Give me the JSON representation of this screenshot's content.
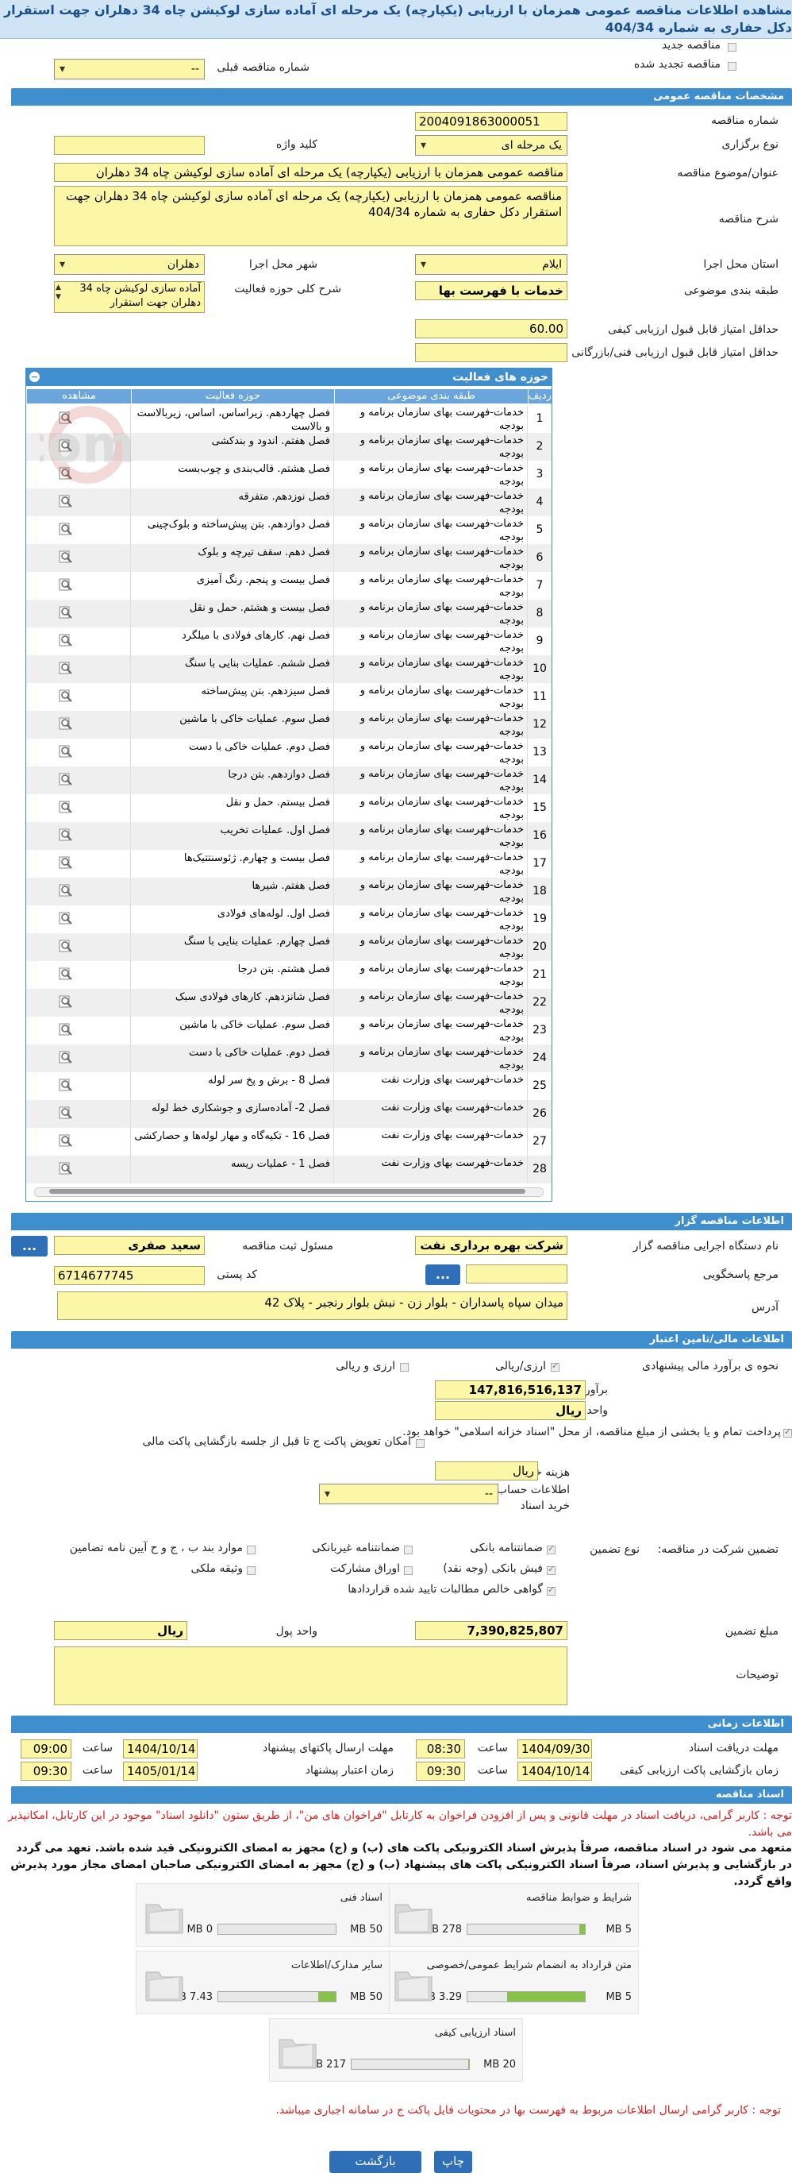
{
  "page": {
    "title": "مشاهده اطلاعات مناقصه عمومی همزمان با ارزیابی (یکپارچه) یک مرحله ای آماده سازی لوکیشن چاه 34 دهلران جهت استقرار دکل حفاری به شماره 404/34"
  },
  "top": {
    "new_tender": "مناقصه جدید",
    "renewed_tender": "مناقصه تجدید شده",
    "prev_tender_label": "شماره مناقصه قبلی",
    "prev_tender_value": "--"
  },
  "general": {
    "section": "مشخصات مناقصه عمومی",
    "tender_no_label": "شماره مناقصه",
    "tender_no": "2004091863000051",
    "type_label": "نوع برگزاری",
    "type_value": "یک مرحله ای",
    "keyword_label": "کلید واژه",
    "keyword_value": "",
    "subject_label": "عنوان/موضوع مناقصه",
    "subject_value": "مناقصه عمومی همزمان با ارزیابی (یکپارچه) یک مرحله ای آماده سازی لوکیشن چاه 34 دهلران",
    "desc_label": "شرح مناقصه",
    "desc_value": "مناقصه عمومی همزمان با ارزیابی (یکپارچه) یک مرحله ای آماده سازی لوکیشن چاه 34 دهلران جهت استقرار دکل حفاری به شماره 404/34",
    "province_label": "استان محل اجرا",
    "province_value": "ایلام",
    "city_label": "شهر محل اجرا",
    "city_value": "دهلران",
    "category_label": "طبقه بندی موضوعی",
    "category_value": "خدمات با فهرست بها",
    "scope_label": "شرح کلی حوزه فعالیت",
    "scope_value": "آماده سازی لوکیشن چاه 34 دهلران جهت استقرار",
    "min_quality_label": "حداقل امتیاز قابل قبول ارزیابی کیفی",
    "min_quality_value": "60.00",
    "min_tech_label": "حداقل امتیاز قابل قبول ارزیابی فنی/بازرگانی",
    "min_tech_value": ""
  },
  "activities": {
    "title": "حوزه های فعالیت",
    "col_row": "ردیف",
    "col_cat": "طبقه بندی موضوعی",
    "col_act": "حوزه فعالیت",
    "col_view": "مشاهده",
    "rows": [
      {
        "n": "1",
        "cat": "خدمات-فهرست بهای سازمان برنامه و بودجه",
        "act": "فصل چهاردهم. زیراساس، اساس، زیربالاست و بالاست"
      },
      {
        "n": "2",
        "cat": "خدمات-فهرست بهای سازمان برنامه و بودجه",
        "act": "فصل هفتم. اندود و بندکشی"
      },
      {
        "n": "3",
        "cat": "خدمات-فهرست بهای سازمان برنامه و بودجه",
        "act": "فصل هشتم. قالب‌بندی و چوب‌بست"
      },
      {
        "n": "4",
        "cat": "خدمات-فهرست بهای سازمان برنامه و بودجه",
        "act": "فصل نوزدهم. متفرقه"
      },
      {
        "n": "5",
        "cat": "خدمات-فهرست بهای سازمان برنامه و بودجه",
        "act": "فصل دوازدهم. بتن پیش‌ساخته و بلوک‌چینی"
      },
      {
        "n": "6",
        "cat": "خدمات-فهرست بهای سازمان برنامه و بودجه",
        "act": "فصل دهم. سقف تیرچه و بلوک"
      },
      {
        "n": "7",
        "cat": "خدمات-فهرست بهای سازمان برنامه و بودجه",
        "act": "فصل بیست و پنجم. رنگ آمیزی"
      },
      {
        "n": "8",
        "cat": "خدمات-فهرست بهای سازمان برنامه و بودجه",
        "act": "فصل بیست و هشتم. حمل و نقل"
      },
      {
        "n": "9",
        "cat": "خدمات-فهرست بهای سازمان برنامه و بودجه",
        "act": "فصل نهم. کارهای فولادی با میلگرد"
      },
      {
        "n": "10",
        "cat": "خدمات-فهرست بهای سازمان برنامه و بودجه",
        "act": "فصل ششم. عملیات بنایی با سنگ"
      },
      {
        "n": "11",
        "cat": "خدمات-فهرست بهای سازمان برنامه و بودجه",
        "act": "فصل سیزدهم. بتن پیش‌ساخته"
      },
      {
        "n": "12",
        "cat": "خدمات-فهرست بهای سازمان برنامه و بودجه",
        "act": "فصل سوم. عملیات خاکی با ماشین"
      },
      {
        "n": "13",
        "cat": "خدمات-فهرست بهای سازمان برنامه و بودجه",
        "act": "فصل دوم. عملیات خاکی با دست"
      },
      {
        "n": "14",
        "cat": "خدمات-فهرست بهای سازمان برنامه و بودجه",
        "act": "فصل دوازدهم. بتن درجا"
      },
      {
        "n": "15",
        "cat": "خدمات-فهرست بهای سازمان برنامه و بودجه",
        "act": "فصل بیستم. حمل و نقل"
      },
      {
        "n": "16",
        "cat": "خدمات-فهرست بهای سازمان برنامه و بودجه",
        "act": "فصل اول. عملیات تخریب"
      },
      {
        "n": "17",
        "cat": "خدمات-فهرست بهای سازمان برنامه و بودجه",
        "act": "فصل بیست و چهارم. ژئوسنتتیک‌ها"
      },
      {
        "n": "18",
        "cat": "خدمات-فهرست بهای سازمان برنامه و بودجه",
        "act": "فصل هفتم. شیرها"
      },
      {
        "n": "19",
        "cat": "خدمات-فهرست بهای سازمان برنامه و بودجه",
        "act": "فصل اول. لوله‌های فولادی"
      },
      {
        "n": "20",
        "cat": "خدمات-فهرست بهای سازمان برنامه و بودجه",
        "act": "فصل چهارم. عملیات بنایی با سنگ"
      },
      {
        "n": "21",
        "cat": "خدمات-فهرست بهای سازمان برنامه و بودجه",
        "act": "فصل هشتم. بتن درجا"
      },
      {
        "n": "22",
        "cat": "خدمات-فهرست بهای سازمان برنامه و بودجه",
        "act": "فصل شانزدهم. کارهای فولادی سبک"
      },
      {
        "n": "23",
        "cat": "خدمات-فهرست بهای سازمان برنامه و بودجه",
        "act": "فصل سوم. عملیات خاکی با ماشین"
      },
      {
        "n": "24",
        "cat": "خدمات-فهرست بهای سازمان برنامه و بودجه",
        "act": "فصل دوم. عملیات خاکی با دست"
      },
      {
        "n": "25",
        "cat": "خدمات-فهرست بهای وزارت نفت",
        "act": "فصل 8 - برش و پخ سر لوله"
      },
      {
        "n": "26",
        "cat": "خدمات-فهرست بهای وزارت نفت",
        "act": "فصل 2- آماده‌سازی و جوشکاری خط لوله"
      },
      {
        "n": "27",
        "cat": "خدمات-فهرست بهای وزارت نفت",
        "act": "فصل 16 - تکیه‌گاه و مهار لوله‌ها و حصارکشی"
      },
      {
        "n": "28",
        "cat": "خدمات-فهرست بهای وزارت نفت",
        "act": "فصل 1 - عملیات ریسه"
      }
    ]
  },
  "organizer": {
    "section": "اطلاعات مناقصه گزار",
    "org_label": "نام دستگاه اجرایی مناقصه گزار",
    "org_value": "شرکت بهره برداری نفت و گ",
    "resp_label": "مسئول ثبت مناقصه",
    "resp_value": "سعید صفری",
    "ref_label": "مرجع پاسخگویی",
    "ref_value": "",
    "postal_label": "کد پستی",
    "postal_value": "6714677745",
    "address_label": "آدرس",
    "address_value": "میدان سپاه پاسداران - بلوار زن - نبش بلوار رنجبر - پلاک 42",
    "more_btn": "...",
    "ref_btn": "..."
  },
  "finance": {
    "section": "اطلاعات مالی/تامین اعتبار",
    "estimate_type_label": "نحوه ی برآورد مالی پیشنهادی",
    "opt_rial": "ارزی/ریالی",
    "opt_rial2": "ارزی و ریالی",
    "estimate_label": "برآورد مالی",
    "estimate_value": "147,816,516,137",
    "currency_label": "واحد پول",
    "currency_value": "ریال",
    "pay_text": "پرداخت تمام و یا بخشی از مبلغ مناقصه، از محل \"اسناد خزانه اسلامی\" خواهد بود.",
    "swap_text": "امکان تعویض پاکت ج تا قبل از جلسه بازگشایی پاکت مالی",
    "doc_cost_label": "هزینه خرید اسناد",
    "doc_cost_unit": "ریال",
    "account_label": "اطلاعات حساب جهت واریز هزینه خرید اسناد",
    "account_value": "--",
    "guarantee_label": "تضمین شرکت در مناقصه:",
    "guarantee_type_label": "نوع تضمین",
    "g_bank": "ضمانتنامه بانکی",
    "g_nonbank": "ضمانتنامه غیربانکی",
    "g_items": "موارد بند ب ، ج و ح آیین نامه تضامین",
    "g_cash": "فیش بانکی (وجه نقد)",
    "g_bonds": "اوراق مشارکت",
    "g_property": "وثیقه ملکی",
    "g_claims": "گواهی خالص مطالبات تایید شده قراردادها",
    "amount_label": "مبلغ تضمین",
    "amount_value": "7,390,825,807",
    "amount_currency_label": "واحد پول",
    "amount_currency_value": "ریال",
    "notes_label": "توضیحات",
    "notes_value": ""
  },
  "timing": {
    "section": "اطلاعات زمانی",
    "doc_deadline_label": "مهلت دریافت اسناد",
    "doc_deadline_date": "1404/09/30",
    "doc_deadline_time": "08:30",
    "send_deadline_label": "مهلت ارسال پاکتهای پیشنهاد",
    "send_deadline_date": "1404/10/14",
    "send_deadline_time": "09:00",
    "open_label": "زمان بازگشایی پاکت ارزیابی کیفی",
    "open_date": "1404/10/14",
    "open_time": "09:30",
    "validity_label": "زمان اعتبار پیشنهاد",
    "validity_date": "1405/01/14",
    "validity_time": "09:30",
    "time_label": "ساعت"
  },
  "docs": {
    "section": "اسناد مناقصه",
    "notice_red": "توجه : کاربر گرامی، دریافت اسناد در مهلت قانونی و پس از افزودن فراخوان به کارتابل \"فراخوان های من\"، از طریق ستون \"دانلود اسناد\" موجود در این کارتابل، امکانپذیر می باشد.",
    "notice_black": "متعهد می شود در اسناد مناقصه، صرفاً پذیرش اسناد الکترونیکی پاکت های (ب) و (ج) مجهز به امضای الکترونیکی قید شده باشد. تعهد می گردد در بازگشایی و پذیرش اسناد، صرفاً اسناد الکترونیکی پاکت های پیشنهاد (ب) و (ج) مجهز به امضای الکترونیکی صاحبان امضای مجاز مورد پذیرش واقع گردد.",
    "cards": [
      {
        "title": "شرایط و ضوابط مناقصه",
        "max": "5 MB",
        "cur": "278 KB",
        "fill": 0.05
      },
      {
        "title": "اسناد فنی",
        "max": "50 MB",
        "cur": "0 MB",
        "fill": 0.0
      },
      {
        "title": "متن قرارداد به انضمام شرایط عمومی/خصوصی",
        "max": "5 MB",
        "cur": "3.29 MB",
        "fill": 0.66
      },
      {
        "title": "سایر مدارک/اطلاعات",
        "max": "50 MB",
        "cur": "7.43 MB",
        "fill": 0.15
      },
      {
        "title": "اسناد ارزیابی کیفی",
        "max": "20 MB",
        "cur": "217 KB",
        "fill": 0.01
      }
    ],
    "footer_note": "توجه : کاربر گرامی ارسال اطلاعات مربوط به فهرست بها در محتویات فایل پاکت ج در سامانه اجباری میباشد."
  },
  "actions": {
    "print": "چاپ",
    "back": "بازگشت"
  },
  "watermark": "AriaTender.com"
}
